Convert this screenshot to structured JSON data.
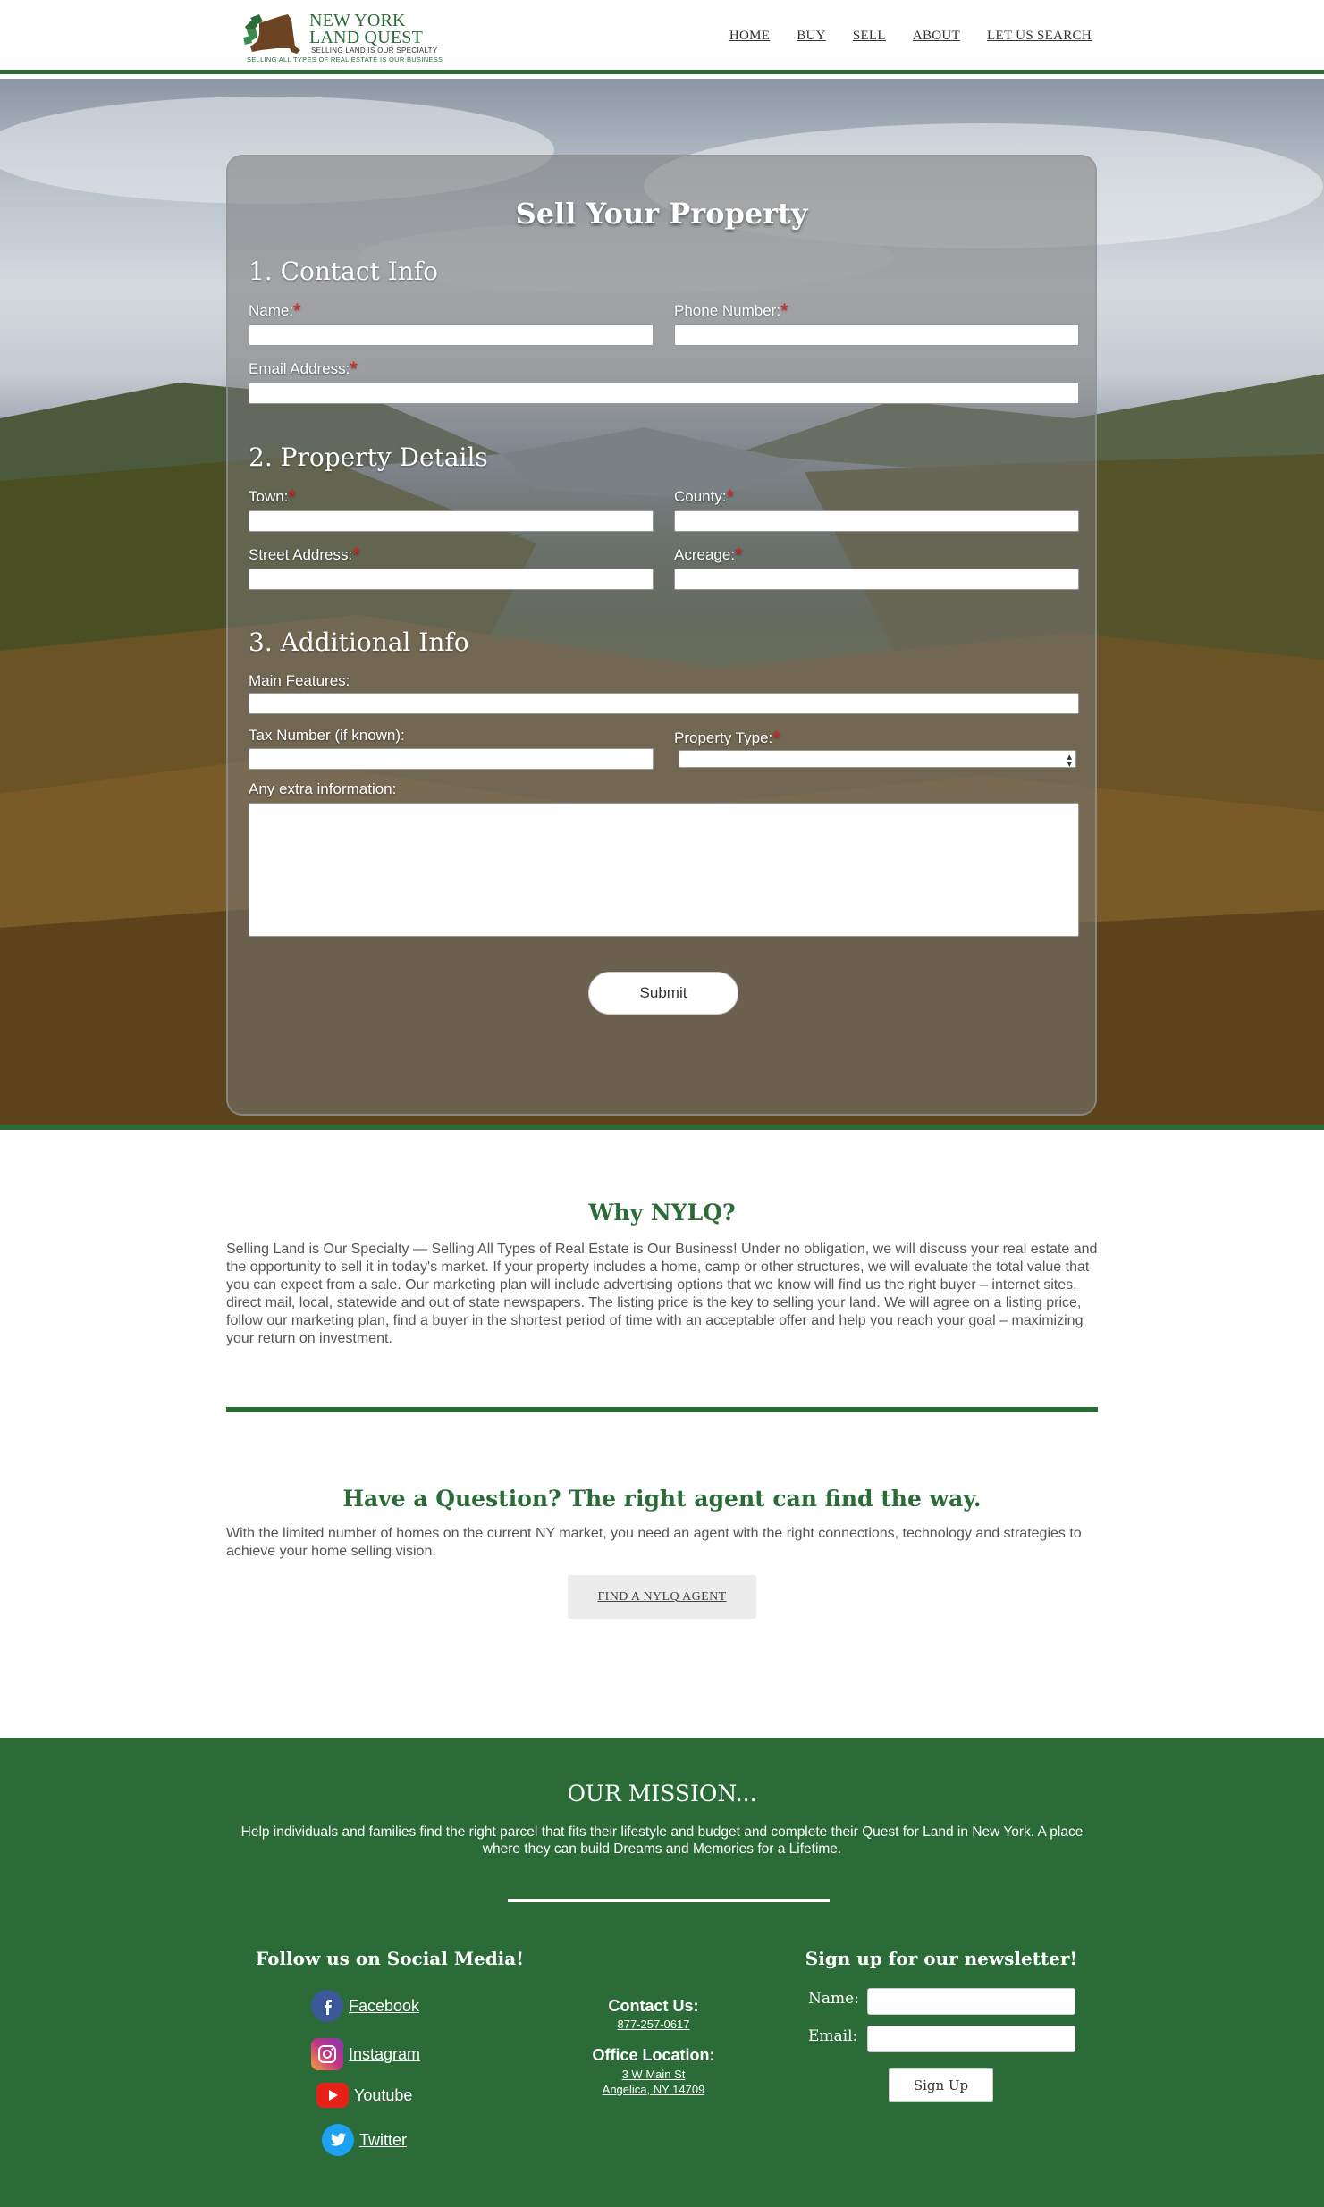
{
  "header": {
    "logo_title_line1": "NEW YORK",
    "logo_title_line2": "LAND QUEST",
    "logo_tagline": "SELLING LAND IS OUR SPECIALTY",
    "logo_subtagline": "SELLING ALL TYPES OF REAL ESTATE IS OUR BUSINESS",
    "nav": [
      "HOME",
      "BUY",
      "SELL",
      "ABOUT",
      "LET US SEARCH"
    ]
  },
  "form": {
    "title": "Sell Your Property",
    "section1": "1. Contact Info",
    "section2": "2. Property Details",
    "section3": "3. Additional Info",
    "required_mark": "*",
    "labels": {
      "name": "Name:",
      "phone": "Phone Number:",
      "email": "Email Address:",
      "town": "Town:",
      "county": "County:",
      "street": "Street Address:",
      "acreage": "Acreage:",
      "features": "Main Features:",
      "tax": "Tax Number (if known):",
      "type": "Property Type:",
      "extra": "Any extra information:"
    },
    "submit": "Submit"
  },
  "why": {
    "title": "Why NYLQ?",
    "text": "Selling Land is Our Specialty — Selling All Types of Real Estate is Our Business! Under no obligation, we will discuss your real estate and the opportunity to sell it in today's market. If your property includes a home, camp or other structures, we will evaluate the total value that you can expect from a sale. Our marketing plan will include advertising options that we know will find us the right buyer – internet sites, direct mail, local, statewide and out of state newspapers. The listing price is the key to selling your land. We will agree on a listing price, follow our marketing plan, find a buyer in the shortest period of time with an acceptable offer and help you reach your goal – maximizing your return on investment."
  },
  "question": {
    "title": "Have a Question? The right agent can find the way.",
    "text": "With the limited number of homes on the current NY market, you need an agent with the right connections, technology and strategies to achieve your home selling vision.",
    "button": "FIND A NYLQ AGENT"
  },
  "footer": {
    "mission_title": "OUR MISSION...",
    "mission_text": "Help individuals and families find the right parcel that fits their lifestyle and budget and complete their Quest for Land in New York. A place where they can build Dreams and Memories for a Lifetime.",
    "social_title": "Follow us on Social Media!",
    "social": [
      {
        "label": "Facebook",
        "icon": "facebook-icon",
        "color": "#3b5998"
      },
      {
        "label": "Instagram",
        "icon": "instagram-icon",
        "color": "#c13584"
      },
      {
        "label": "Youtube",
        "icon": "youtube-icon",
        "color": "#e62117"
      },
      {
        "label": "Twitter",
        "icon": "twitter-icon",
        "color": "#1da1f2"
      }
    ],
    "contact_head": "Contact Us:",
    "phone": "877-257-0617",
    "office_head": "Office Location:",
    "address1": "3 W Main St",
    "address2": "Angelica, NY 14709",
    "newsletter_title": "Sign up for our newsletter!",
    "news_name_label": "Name:",
    "news_email_label": "Email:",
    "signup": "Sign Up"
  },
  "colors": {
    "brand_green": "#2a6b38",
    "required_red": "#e02020"
  }
}
